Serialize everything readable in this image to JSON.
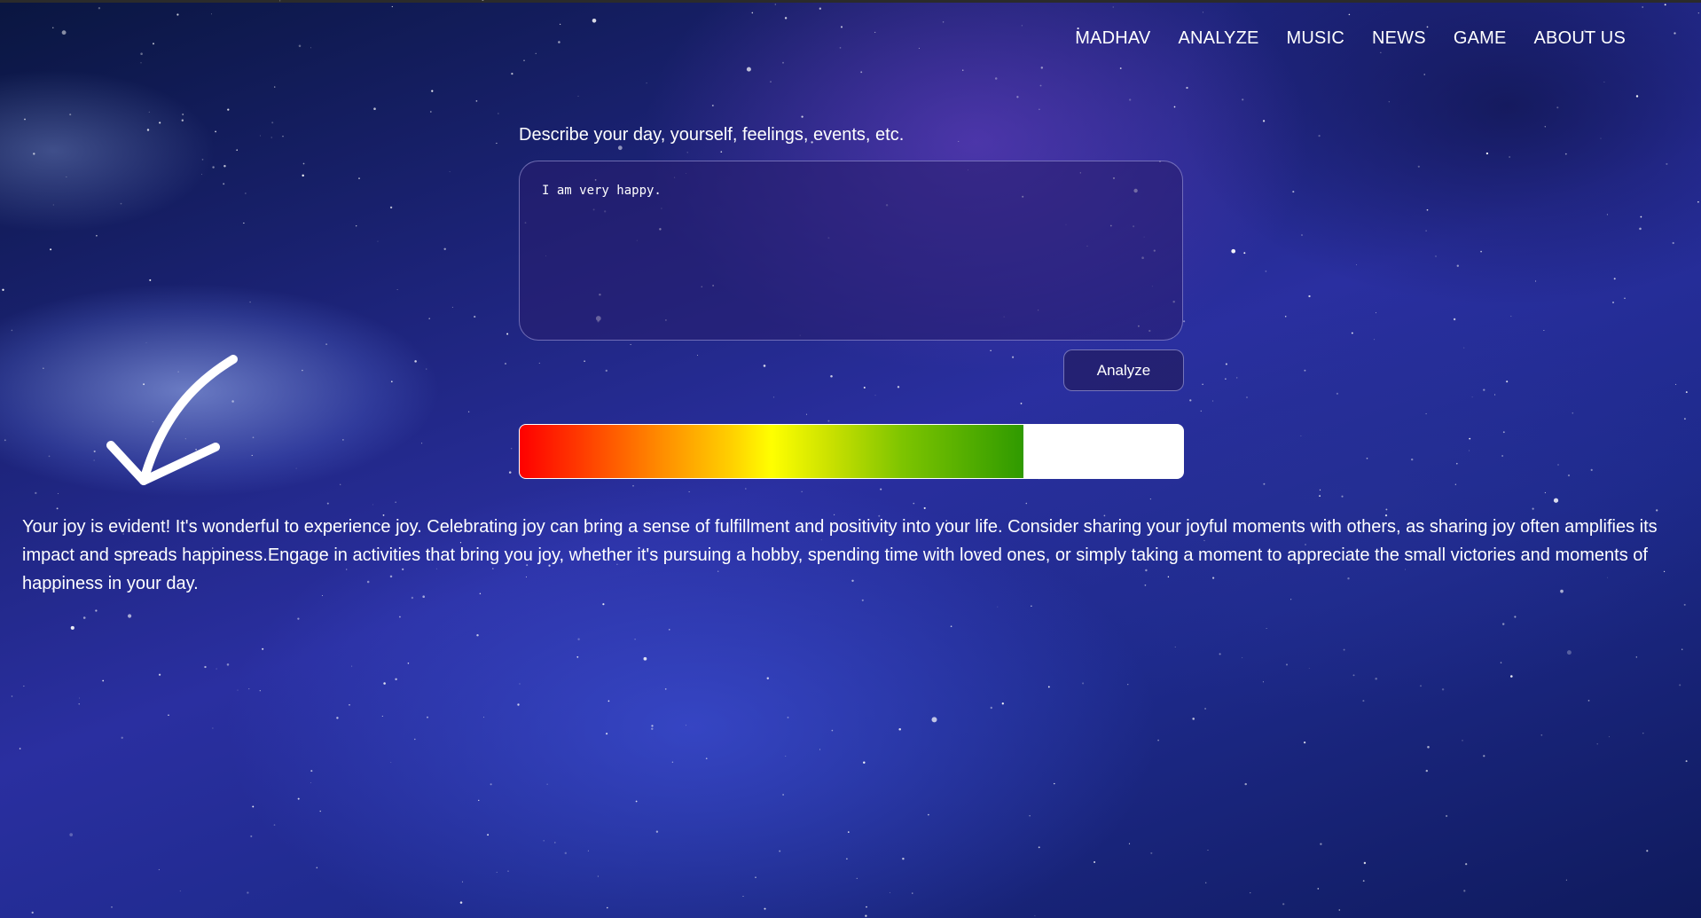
{
  "nav": {
    "items": [
      "MADHAV",
      "ANALYZE",
      "MUSIC",
      "NEWS",
      "GAME",
      "ABOUT US"
    ]
  },
  "form": {
    "prompt_label": "Describe your day, yourself, feelings, events, etc.",
    "entry_value": "I am very happy.",
    "analyze_button": "Analyze"
  },
  "meter": {
    "fill_fraction": 0.76,
    "colors": [
      "#ff0000",
      "#ff8c00",
      "#ffff00",
      "#7dc400",
      "#2f9a00"
    ]
  },
  "result": {
    "text": "Your joy is evident! It's wonderful to experience joy. Celebrating joy can bring a sense of fulfillment and positivity into your life. Consider sharing your joyful moments with others, as sharing joy often amplifies its impact and spreads happiness.Engage in activities that bring you joy, whether it's pursuing a hobby, spending time with loved ones, or simply taking a moment to appreciate the small victories and moments of happiness in your day."
  },
  "theme": {
    "text_color": "#ffffff",
    "background_style": "starry night galaxy"
  }
}
